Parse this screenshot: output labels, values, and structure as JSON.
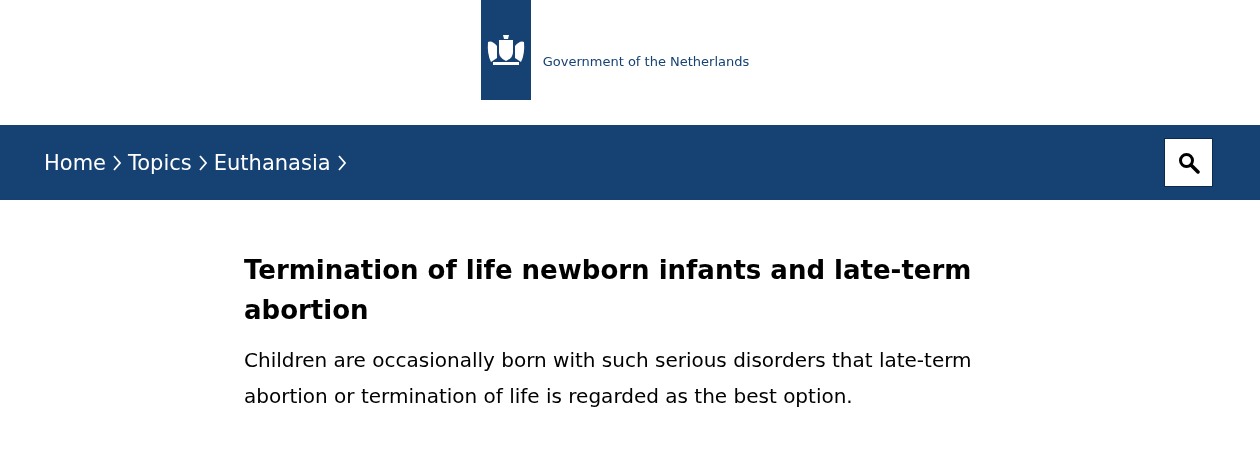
{
  "header": {
    "site_name": "Government of the Netherlands"
  },
  "breadcrumb": [
    "Home",
    "Topics",
    "Euthanasia"
  ],
  "article": {
    "title": "Termination of life newborn infants and late-term abortion",
    "intro": "Children are occasionally born with such serious disorders that late-term abortion or termination of life is regarded as the best option."
  }
}
